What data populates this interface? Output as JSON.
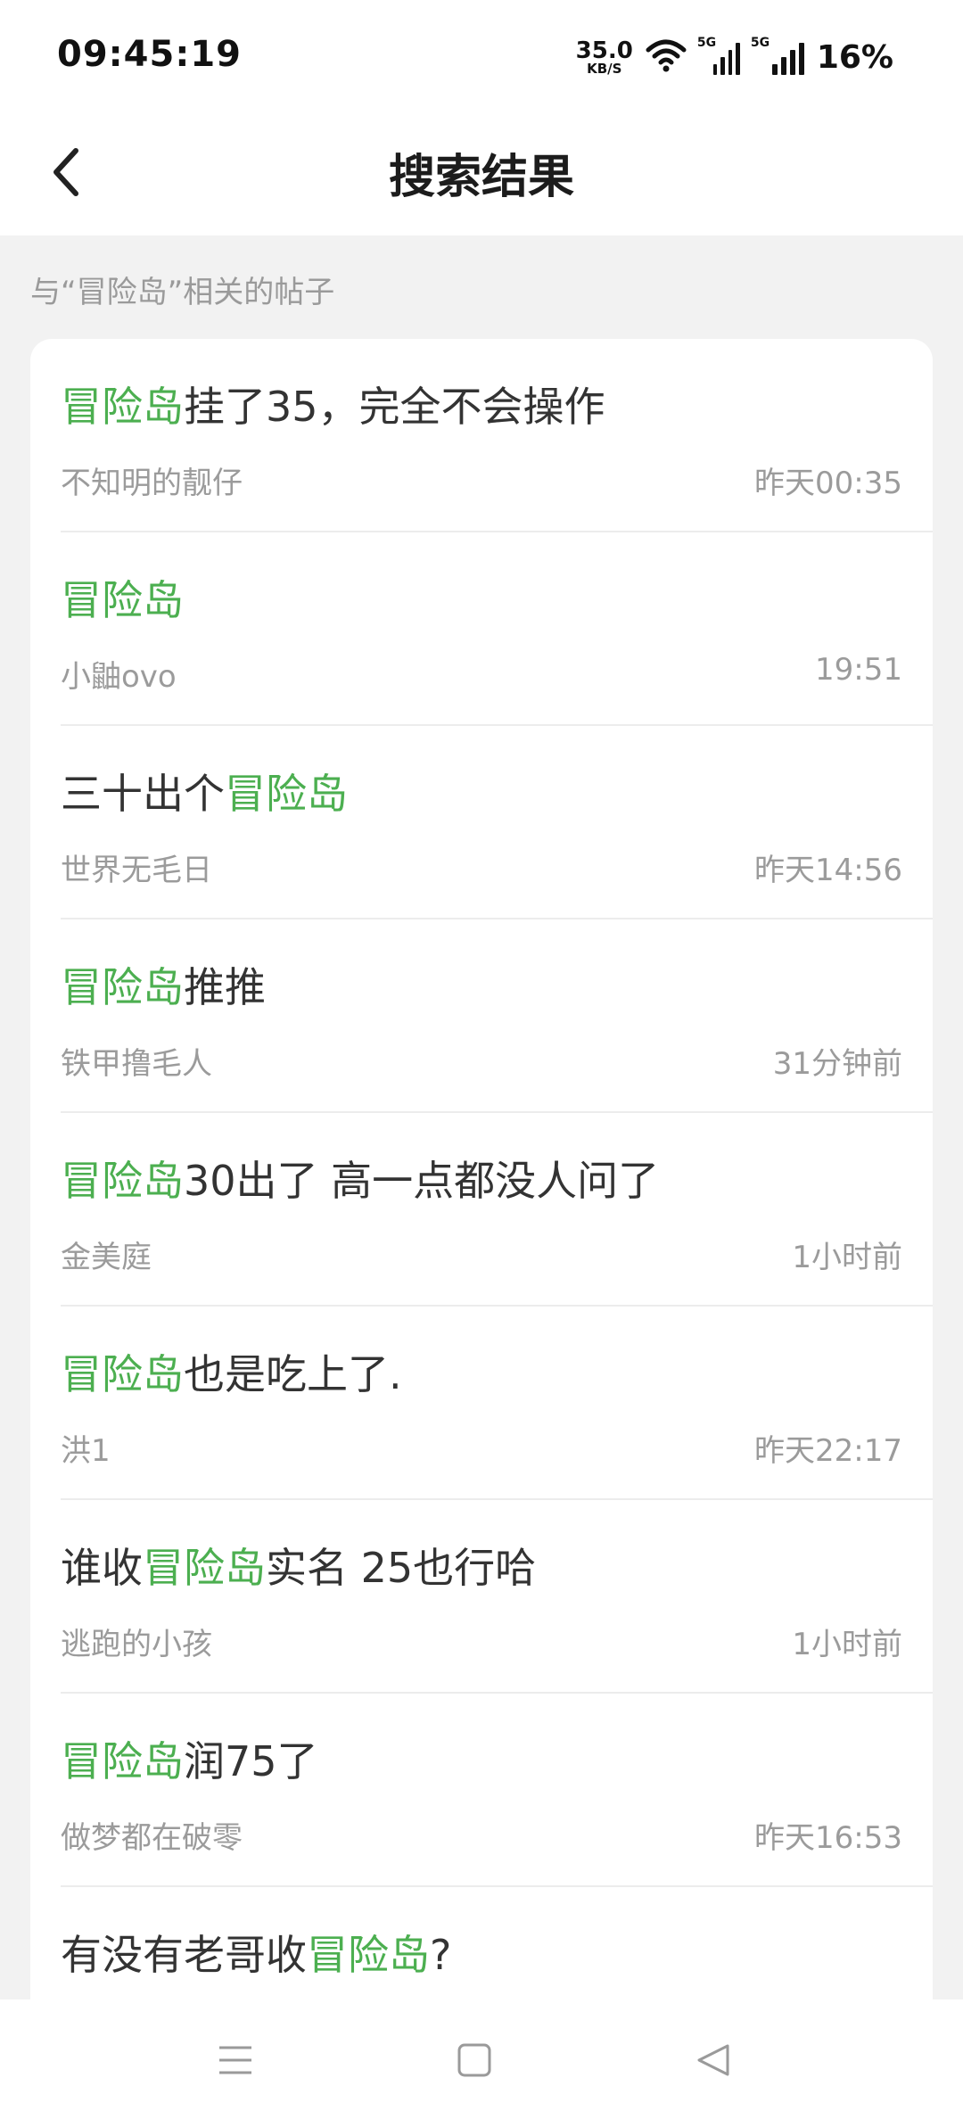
{
  "status_bar": {
    "time": "09:45:19",
    "net_speed_value": "35.0",
    "net_speed_unit": "KB/S",
    "sim1_tag": "5G",
    "sim2_tag": "5G",
    "battery": "16%",
    "icons": [
      "wifi-icon",
      "signal-icon",
      "signal-icon"
    ]
  },
  "header": {
    "title": "搜索结果",
    "back_icon": "chevron-left-icon"
  },
  "section_label": "与“冒险岛”相关的帖子",
  "accent_color": "#4caf50",
  "posts": [
    {
      "pre": "",
      "hl": "冒险岛",
      "post": "挂了35，完全不会操作",
      "author": "不知明的靓仔",
      "time": "昨天00:35"
    },
    {
      "pre": "",
      "hl": "冒险岛",
      "post": "",
      "author": "小鼬ovo",
      "time": "19:51"
    },
    {
      "pre": "三十出个",
      "hl": "冒险岛",
      "post": "",
      "author": "世界无毛日",
      "time": "昨天14:56"
    },
    {
      "pre": "",
      "hl": "冒险岛",
      "post": "推推",
      "author": "铁甲撸毛人",
      "time": "31分钟前"
    },
    {
      "pre": "",
      "hl": "冒险岛",
      "post": "30出了 高一点都没人问了",
      "author": "金美庭",
      "time": "1小时前"
    },
    {
      "pre": "",
      "hl": "冒险岛",
      "post": "也是吃上了.",
      "author": "洪1",
      "time": "昨天22:17"
    },
    {
      "pre": "谁收",
      "hl": "冒险岛",
      "post": "实名 25也行哈",
      "author": "逃跑的小孩",
      "time": "1小时前"
    },
    {
      "pre": "",
      "hl": "冒险岛",
      "post": "润75了",
      "author": "做梦都在破零",
      "time": "昨天16:53"
    },
    {
      "pre": "有没有老哥收",
      "hl": "冒险岛",
      "post": "?",
      "author": "",
      "time": ""
    }
  ],
  "nav_bar": {
    "icons": [
      "menu-icon",
      "home-square-icon",
      "back-triangle-icon"
    ]
  }
}
